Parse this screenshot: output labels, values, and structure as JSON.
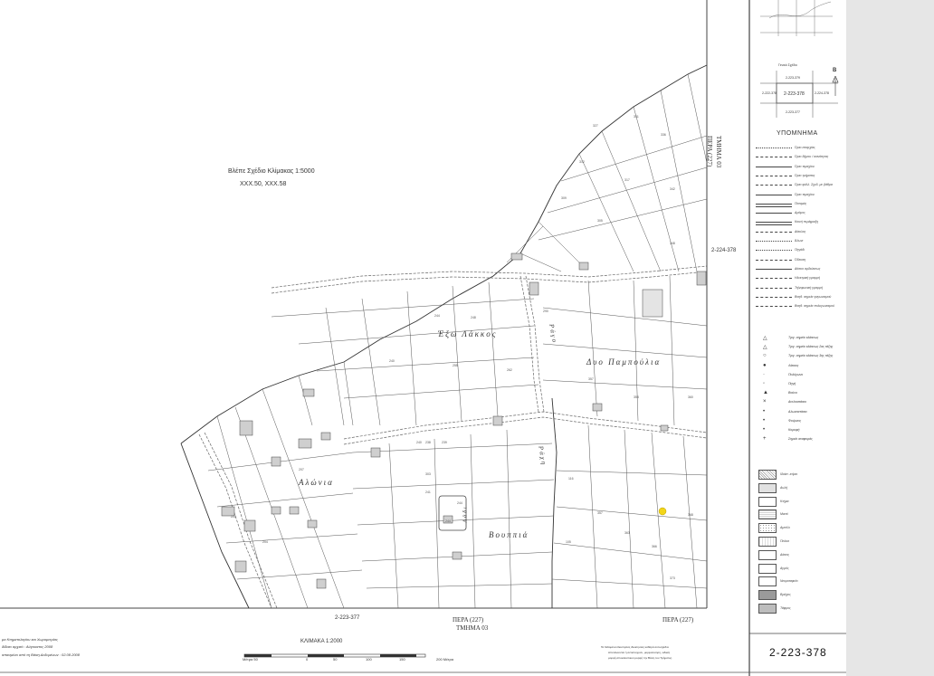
{
  "map": {
    "inset_title_line1": "Βλέπε Σχέδιο Κλίμακας 1:5000",
    "inset_title_line2": "XXX.50, XXX.58",
    "place_exo_lakkos": "Έξω Λάκκος",
    "place_dyo_pampoulia": "Δυο Παμπούλια",
    "place_alonia": "Αλώνια",
    "place_vouppia": "Βουππιά",
    "place_rago": "Ράγο",
    "place_ladi": "Λάδι",
    "place_rachi": "Ράχη",
    "adjacent_sheet_east": "2-224-378",
    "adjacent_sheet_south": "2-223-377",
    "village_right_vertical_line1": "ΠΕΡΑ (227)",
    "village_right_vertical_line2": "ΤΜΗΜΑ 03",
    "village_bottom_line1": "ΠΕΡΑ (227)",
    "village_bottom_line2": "ΤΜΗΜΑ 03",
    "village_bottom_right": "ΠΕΡΑ (227)",
    "highlight_parcel_color": "#f2d51a"
  },
  "legend": {
    "general_plan_label": "Γενικό Σχέδιο",
    "key_center": "2-223-378",
    "key_north": "2-223-379",
    "key_south": "2-223-377",
    "key_west": "2-222-378",
    "key_east": "2-224-378",
    "north_letter": "Β",
    "title": "ΥΠΟΜΝΗΜΑ",
    "line_items": [
      "Όριο επαρχίας",
      "Όριο δήμου / κοινότητας",
      "Όριο τεμαχίου",
      "Όριο τμήματος",
      "Όριο φύλλ. Σχεδ. με βάθρα",
      "Όριο τεμαχίου",
      "Ποταμός",
      "Δρόμος",
      "Κοινή περίφραξη",
      "Δίαυλος",
      "Άλωνι",
      "Πηγάδι",
      "Όδευση",
      "Δίκτυο αρδεύσεως",
      "Ηλεκτρική γραμμή",
      "Τηλεφωνική γραμμή",
      "Βοηθ. σημεία τριγωνισμού",
      "Βοηθ. σημεία πολυγωνισμού"
    ],
    "point_items": [
      "Τριγ. σημείο κλάσεως",
      "Τριγ. σημείο κλάσεως 2ας τάξης",
      "Τριγ. σημείο κλάσεως 3ης τάξης",
      "Λάκκος",
      "Πολύγωνο",
      "Πηγή",
      "Βούνο",
      "Αντλιοστάσιο",
      "Αλωνοστάσιο",
      "Φούρνος",
      "Κορυφή",
      "Σημείο αναφοράς"
    ],
    "area_items": [
      "Ιδιόκτ. κτίριο",
      "Αυλή",
      "Κτήμα",
      "Μικτό",
      "Αμπέλι",
      "Πεύκα",
      "Δάσος",
      "Αγρός",
      "Νεκροταφείο",
      "Βράχος",
      "Τάφρος"
    ]
  },
  "footer": {
    "scale_title": "ΚΛΙΜΑΚΑ 1:2000",
    "scale_unit_label": "Μέτρα 50",
    "scale_ticks": [
      "0",
      "50",
      "100",
      "150",
      "200 Μέτρα"
    ],
    "agency_line1": "μα Κτηματολογίου και Χωρομετρίας",
    "agency_line2": "δίδαιο αρχικό : Αύγουστος 2008",
    "agency_line3": "σπασμένο από τη Βάση Δεδομένων : 02.08.2008",
    "note_line1": "Τα δεδομένα ιδιοκτησίας ιδιοκτησίας καθαρά αυτοσχέδια.",
    "note_line2": "Αποτελούνται ή αντιστοιχούν, μορφοποίηση, ειδικές",
    "note_line3": "μορφή αποκλειστικού μορφή την Βάση του Τμήματος.",
    "sheet_number": "2-223-378"
  }
}
